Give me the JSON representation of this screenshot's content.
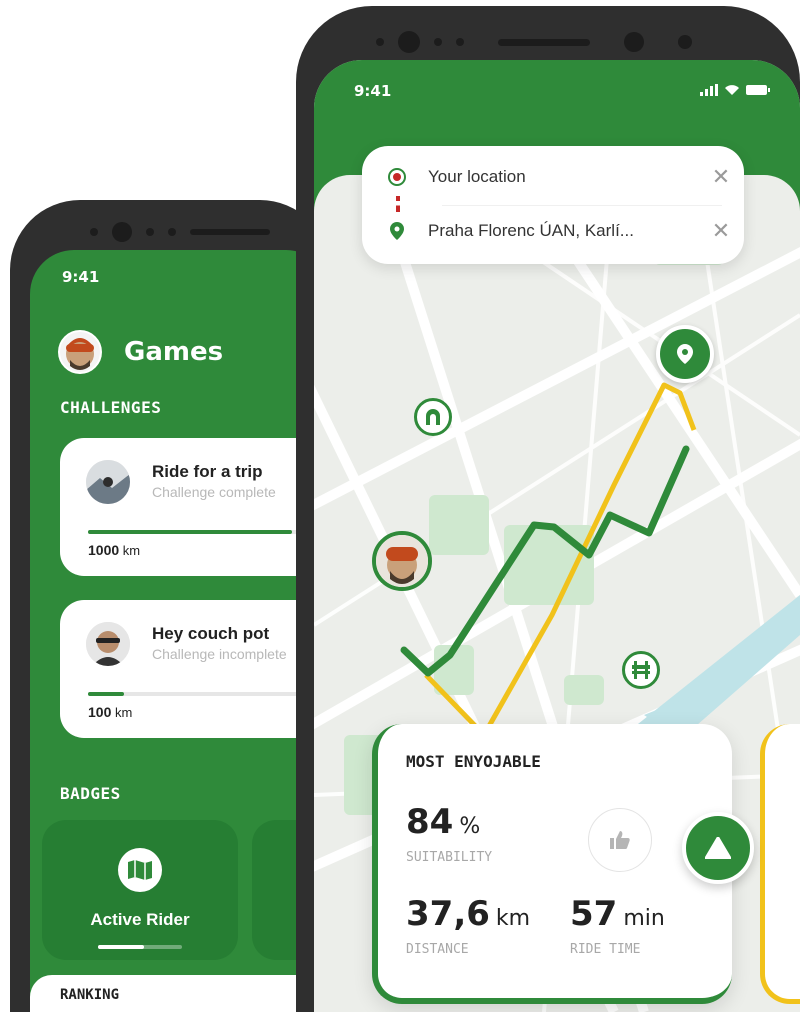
{
  "back_phone": {
    "status_time": "9:41",
    "title": "Games",
    "challenges_label": "CHALLENGES",
    "challenges": [
      {
        "title": "Ride for a trip",
        "subtitle": "Challenge complete",
        "distance_value": "1000",
        "distance_unit": "km",
        "progress": 0.85
      },
      {
        "title": "Hey couch pot",
        "subtitle": "Challenge incomplete",
        "distance_value": "100",
        "distance_unit": "km",
        "progress": 0.15
      }
    ],
    "badges_label": "BADGES",
    "badges": [
      {
        "label": "Active Rider",
        "icon": "map-icon",
        "progress": 0.55
      }
    ],
    "ranking_label": "RANKING"
  },
  "front_phone": {
    "status_time": "9:41",
    "search": {
      "origin": "Your location",
      "destination": "Praha Florenc ÚAN, Karlí...",
      "close_glyph": "✕"
    },
    "route_card": {
      "title": "MOST ENYOJABLE",
      "suitability_value": "84",
      "suitability_unit": "%",
      "suitability_label": "SUITABILITY",
      "distance_value": "37,6",
      "distance_unit": "km",
      "distance_label": "DISTANCE",
      "ride_time_value": "57",
      "ride_time_unit": "min",
      "ride_time_label": "RIDE TIME"
    },
    "colors": {
      "brand_green": "#2f8a3a",
      "route_primary": "#2f8a3a",
      "route_alt": "#f1c21b",
      "water": "#bfe3e8",
      "park": "#cfe8cf"
    }
  }
}
